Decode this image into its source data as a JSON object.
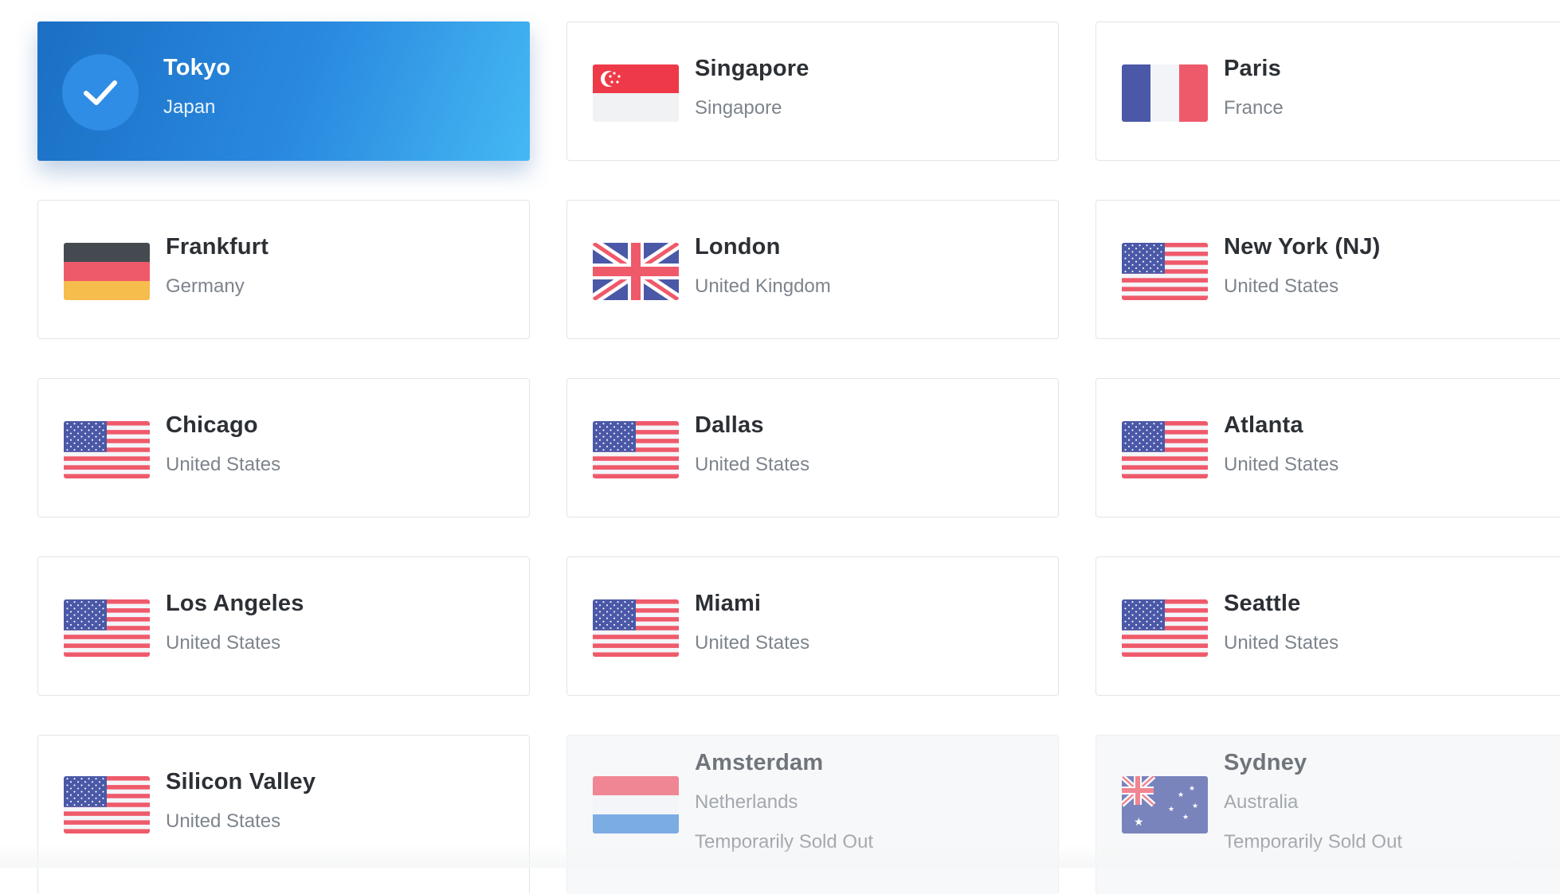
{
  "locations": [
    {
      "city": "Tokyo",
      "country": "Japan",
      "flag": "check-icon",
      "state": "selected"
    },
    {
      "city": "Singapore",
      "country": "Singapore",
      "flag": "singapore-flag-icon",
      "state": "available"
    },
    {
      "city": "Paris",
      "country": "France",
      "flag": "france-flag-icon",
      "state": "available"
    },
    {
      "city": "Frankfurt",
      "country": "Germany",
      "flag": "germany-flag-icon",
      "state": "available"
    },
    {
      "city": "London",
      "country": "United Kingdom",
      "flag": "uk-flag-icon",
      "state": "available"
    },
    {
      "city": "New York (NJ)",
      "country": "United States",
      "flag": "us-flag-icon",
      "state": "available"
    },
    {
      "city": "Chicago",
      "country": "United States",
      "flag": "us-flag-icon",
      "state": "available"
    },
    {
      "city": "Dallas",
      "country": "United States",
      "flag": "us-flag-icon",
      "state": "available"
    },
    {
      "city": "Atlanta",
      "country": "United States",
      "flag": "us-flag-icon",
      "state": "available"
    },
    {
      "city": "Los Angeles",
      "country": "United States",
      "flag": "us-flag-icon",
      "state": "available"
    },
    {
      "city": "Miami",
      "country": "United States",
      "flag": "us-flag-icon",
      "state": "available"
    },
    {
      "city": "Seattle",
      "country": "United States",
      "flag": "us-flag-icon",
      "state": "available"
    },
    {
      "city": "Silicon Valley",
      "country": "United States",
      "flag": "us-flag-icon",
      "state": "available"
    },
    {
      "city": "Amsterdam",
      "country": "Netherlands",
      "flag": "netherlands-flag-icon",
      "state": "soldout",
      "note": "Temporarily Sold Out"
    },
    {
      "city": "Sydney",
      "country": "Australia",
      "flag": "australia-flag-icon",
      "state": "soldout",
      "note": "Temporarily Sold Out"
    }
  ],
  "colors": {
    "selected_gradient_start": "#1b6fc4",
    "selected_gradient_end": "#45b8f3",
    "city_text": "#2c3035",
    "country_text": "#7d848c",
    "card_border": "#e2e4e8"
  }
}
